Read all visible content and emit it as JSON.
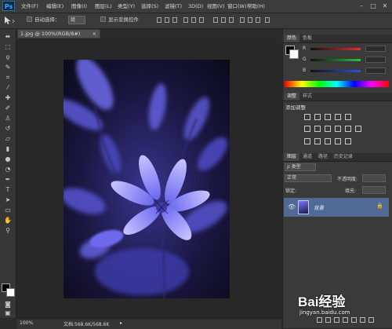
{
  "app": {
    "logo": "Ps"
  },
  "menu": [
    "文件(F)",
    "编辑(E)",
    "图像(I)",
    "图层(L)",
    "类型(Y)",
    "选择(S)",
    "滤镜(T)",
    "3D(D)",
    "视图(V)",
    "窗口(W)",
    "帮助(H)"
  ],
  "window_controls": {
    "minimize": "–",
    "maximize": "□",
    "close": "✕"
  },
  "options": {
    "auto_select_label": "自动选择：",
    "auto_select_value": "组",
    "show_transform_label": "显示变换控件"
  },
  "document": {
    "tab_title": "1.jpg @ 100%(RGB/8#)",
    "tab_close": "×",
    "zoom": "100%",
    "doc_info": "文档:568.6K/568.6K",
    "status_arrow": "▸"
  },
  "color_panel": {
    "tabs": [
      "颜色",
      "色板"
    ],
    "channels": [
      {
        "label": "R",
        "value": "",
        "color": "#e03030"
      },
      {
        "label": "G",
        "value": "",
        "color": "#30c040"
      },
      {
        "label": "B",
        "value": "",
        "color": "#3050e0"
      }
    ]
  },
  "adjustments_panel": {
    "tabs": [
      "调整",
      "样式"
    ],
    "title": "添加调整"
  },
  "layers_panel": {
    "tabs": [
      "图层",
      "通道",
      "路径",
      "历史记录"
    ],
    "filter_label": "ρ 类型",
    "blend_mode": "正常",
    "opacity_label": "不透明度:",
    "opacity_value": "",
    "lock_label": "锁定:",
    "fill_label": "填充:",
    "fill_value": "",
    "layers": [
      {
        "name": "背景",
        "visible": true,
        "locked": true
      }
    ]
  },
  "watermark": {
    "text": "Bai经验",
    "subtext": "jingyan.baidu.com"
  },
  "colors": {
    "accent": "#41a8ff",
    "flower_blue": "#7a78ff",
    "background": "#282828",
    "panel": "#3a3a3a"
  }
}
